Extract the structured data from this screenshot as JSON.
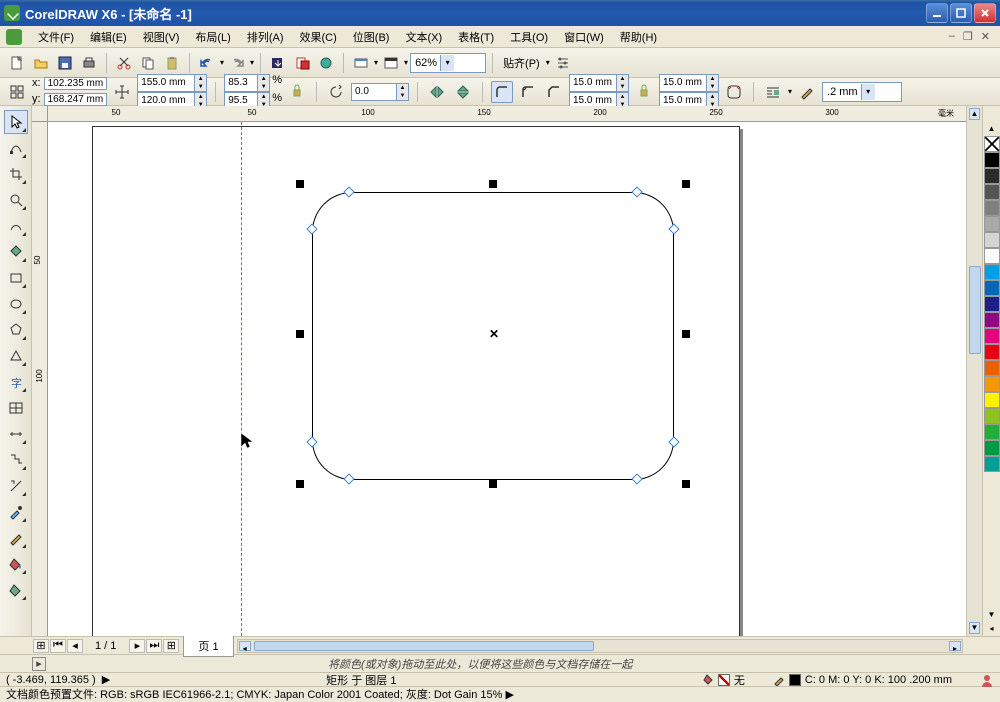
{
  "title": "CorelDRAW X6 - [未命名 -1]",
  "menu": {
    "file": "文件(F)",
    "edit": "编辑(E)",
    "view": "视图(V)",
    "layout": "布局(L)",
    "arrange": "排列(A)",
    "effects": "效果(C)",
    "bitmap": "位图(B)",
    "text": "文本(X)",
    "table": "表格(T)",
    "tools": "工具(O)",
    "window": "窗口(W)",
    "help": "帮助(H)"
  },
  "toolbar": {
    "zoom": "62%",
    "align": "贴齐(P)"
  },
  "prop": {
    "x_lbl": "x:",
    "y_lbl": "y:",
    "x": "102.235 mm",
    "y": "168.247 mm",
    "w": "155.0 mm",
    "h": "120.0 mm",
    "sx": "85.3",
    "sy": "95.5",
    "pct": "%",
    "rot": "0.0",
    "c1a": "15.0 mm",
    "c1b": "15.0 mm",
    "c2a": "15.0 mm",
    "c2b": "15.0 mm",
    "outline": ".2 mm"
  },
  "ruler_h": {
    "ticks": [
      "50",
      "100",
      "150",
      "200",
      "250",
      "300"
    ],
    "unit": "毫米"
  },
  "ruler_h_left": "50",
  "ruler_v": [
    "50",
    "100"
  ],
  "pagenav": {
    "pages": "1 / 1",
    "tab": "页 1"
  },
  "dock_hint": "将颜色(或对象)拖动至此处，以便将这些颜色与文档存储在一起",
  "status": {
    "coords": "( -3.469, 119.365 )",
    "arrow": "▶",
    "shape": "矩形 于 图层 1",
    "fill_label": "无",
    "cmyk": "C: 0 M: 0 Y: 0 K: 100  .200 mm"
  },
  "status2": "文档颜色预置文件: RGB: sRGB IEC61966-2.1; CMYK: Japan Color 2001 Coated; 灰度: Dot Gain 15%  ▶",
  "palette": [
    "#000000",
    "#2b2b2b",
    "#555555",
    "#808080",
    "#aaaaaa",
    "#d4d4d4",
    "#ffffff",
    "#00a0e9",
    "#0068b7",
    "#1d2088",
    "#920783",
    "#e4007f",
    "#e60012",
    "#eb6100",
    "#f39800",
    "#fff100",
    "#8fc31f",
    "#22ac38",
    "#009944",
    "#009e96"
  ],
  "rect": {
    "radius_px": 40
  }
}
